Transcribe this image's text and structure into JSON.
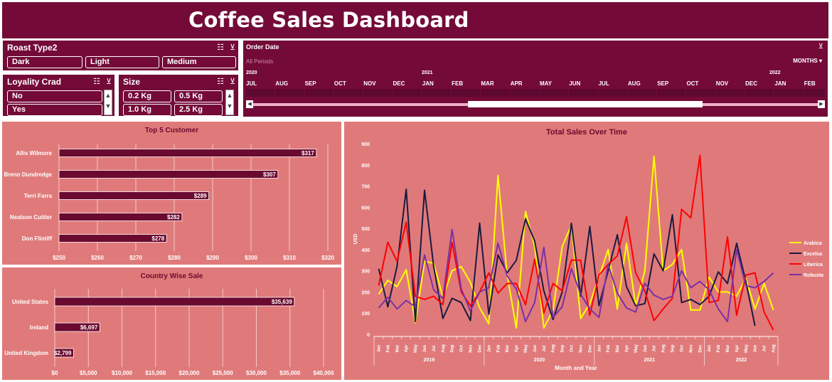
{
  "dashboard": {
    "title": "Coffee Sales Dashboard"
  },
  "slicers": {
    "roast": {
      "header": "Roast Type2",
      "items": [
        "Dark",
        "Light",
        "Medium"
      ]
    },
    "loyalty": {
      "header": "Loyality Crad",
      "items": [
        "No",
        "Yes"
      ]
    },
    "size": {
      "header": "Size",
      "items": [
        "0.2 Kg",
        "0.5 Kg",
        "1.0 Kg",
        "2.5 Kg"
      ]
    }
  },
  "timeline": {
    "header": "Order Date",
    "periods": "All Periods",
    "level": "MONTHS ▾",
    "years": [
      "2020",
      "2021",
      "2022"
    ],
    "months": [
      "JUL",
      "AUG",
      "SEP",
      "OCT",
      "NOV",
      "DEC",
      "JAN",
      "FEB",
      "MAR",
      "APR",
      "MAY",
      "JUN",
      "JUL",
      "AUG",
      "SEP",
      "OCT",
      "NOV",
      "DEC",
      "JAN",
      "FEB"
    ]
  },
  "chart_data": [
    {
      "type": "bar",
      "orientation": "horizontal",
      "title": "Top 5 Customer",
      "categories": [
        "Allis Wilmore",
        "Brenn Dundredge",
        "Terri Farra",
        "Nealson Cuttler",
        "Don Flintiff"
      ],
      "values": [
        317,
        307,
        289,
        282,
        278
      ],
      "data_labels": [
        "$317",
        "$307",
        "$289",
        "$282",
        "$278"
      ],
      "xlim": [
        250,
        320
      ],
      "x_ticks": [
        250,
        260,
        270,
        280,
        290,
        300,
        310,
        320
      ],
      "x_tick_labels": [
        "$250",
        "$260",
        "$270",
        "$280",
        "$290",
        "$300",
        "$310",
        "$320"
      ],
      "grid": true,
      "bar_color": "#6b0a30"
    },
    {
      "type": "bar",
      "orientation": "horizontal",
      "title": "Country Wise Sale",
      "categories": [
        "United States",
        "Ireland",
        "United Kingdom"
      ],
      "values": [
        35639,
        6697,
        2799
      ],
      "data_labels": [
        "$35,639",
        "$6,697",
        "$2,799"
      ],
      "xlim": [
        0,
        40000
      ],
      "x_ticks": [
        0,
        5000,
        10000,
        15000,
        20000,
        25000,
        30000,
        35000,
        40000
      ],
      "x_tick_labels": [
        "$0",
        "$5,000",
        "$10,000",
        "$15,000",
        "$20,000",
        "$25,000",
        "$30,000",
        "$35,000",
        "$40,000"
      ],
      "grid": true,
      "bar_color": "#6b0a30"
    },
    {
      "type": "line",
      "title": "Total Sales Over Time",
      "xlabel": "Month and Year",
      "ylabel": "USD",
      "ylim": [
        0,
        900
      ],
      "y_ticks": [
        0,
        100,
        200,
        300,
        400,
        500,
        600,
        700,
        800,
        900
      ],
      "month_labels": [
        "Jan",
        "Feb",
        "Mar",
        "Apr",
        "May",
        "Jun",
        "Jul",
        "Aug",
        "Sep",
        "Oct",
        "Nov",
        "Dec"
      ],
      "year_groups": [
        {
          "year": "2019",
          "count": 12
        },
        {
          "year": "2020",
          "count": 12
        },
        {
          "year": "2021",
          "count": 12
        },
        {
          "year": "2022",
          "count": 8
        }
      ],
      "legend_placement": "right",
      "grid": false,
      "series": [
        {
          "name": "Arabica",
          "color": "#ffff00",
          "values": [
            190,
            255,
            225,
            305,
            55,
            345,
            335,
            175,
            300,
            320,
            245,
            125,
            50,
            750,
            280,
            30,
            580,
            415,
            30,
            115,
            415,
            515,
            75,
            145,
            270,
            400,
            120,
            430,
            135,
            300,
            840,
            300,
            330,
            400,
            115,
            115,
            270,
            200,
            200,
            180,
            265,
            120,
            240,
            115
          ]
        },
        {
          "name": "Excelsa",
          "color": "#1a1a40",
          "values": [
            310,
            130,
            320,
            685,
            60,
            680,
            320,
            75,
            170,
            150,
            65,
            525,
            95,
            375,
            290,
            350,
            545,
            440,
            205,
            70,
            200,
            525,
            180,
            510,
            135,
            300,
            470,
            225,
            135,
            145,
            380,
            300,
            565,
            150,
            165,
            140,
            180,
            295,
            240,
            430,
            250,
            40
          ]
        },
        {
          "name": "Liberica",
          "color": "#ff0000",
          "values": [
            230,
            435,
            345,
            530,
            180,
            165,
            180,
            140,
            435,
            200,
            135,
            200,
            290,
            195,
            240,
            240,
            140,
            355,
            100,
            240,
            205,
            350,
            350,
            90,
            280,
            330,
            370,
            555,
            290,
            205,
            65,
            120,
            170,
            590,
            550,
            845,
            150,
            160,
            460,
            90,
            280,
            290,
            105,
            20
          ]
        },
        {
          "name": "Robusta",
          "color": "#7a30a8",
          "values": [
            125,
            175,
            120,
            160,
            130,
            375,
            210,
            170,
            495,
            215,
            110,
            200,
            220,
            430,
            275,
            215,
            60,
            150,
            410,
            80,
            130,
            310,
            190,
            120,
            80,
            330,
            195,
            125,
            105,
            240,
            185,
            165,
            180,
            300,
            220,
            250,
            210,
            120,
            60,
            400,
            230,
            220,
            250,
            290,
            145
          ]
        }
      ]
    }
  ]
}
